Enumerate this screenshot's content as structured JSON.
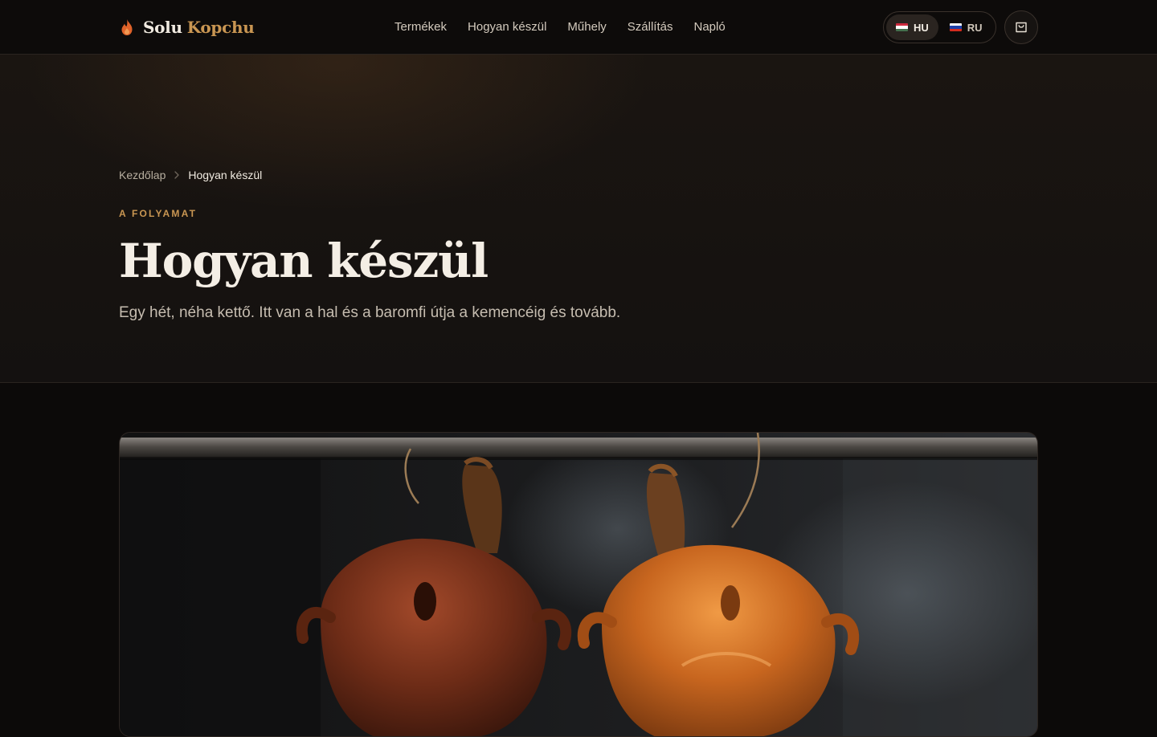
{
  "brand": {
    "name_part1": "Solu",
    "name_part2": "Kopchu",
    "logo_icon": "flame-icon",
    "accent": "#c99652",
    "flame_color": "#e0632a"
  },
  "nav": {
    "items": [
      {
        "label": "Termékek"
      },
      {
        "label": "Hogyan készül"
      },
      {
        "label": "Műhely"
      },
      {
        "label": "Szállítás"
      },
      {
        "label": "Napló"
      }
    ]
  },
  "language": {
    "options": [
      {
        "code": "HU",
        "flag": "hungary-flag-icon",
        "active": true
      },
      {
        "code": "RU",
        "flag": "russia-flag-icon",
        "active": false
      }
    ]
  },
  "cart": {
    "icon": "cart-icon"
  },
  "hero": {
    "breadcrumb": {
      "home": "Kezdőlap",
      "separator_icon": "chevron-right-icon",
      "current": "Hogyan készül"
    },
    "eyebrow": "A FOLYAMAT",
    "title": "Hogyan készül",
    "lede": "Egy hét, néha kettő. Itt van a hal és a baromfi útja a kemencéig és tovább."
  },
  "feature_image": {
    "subject": "smoked-poultry-photo"
  }
}
